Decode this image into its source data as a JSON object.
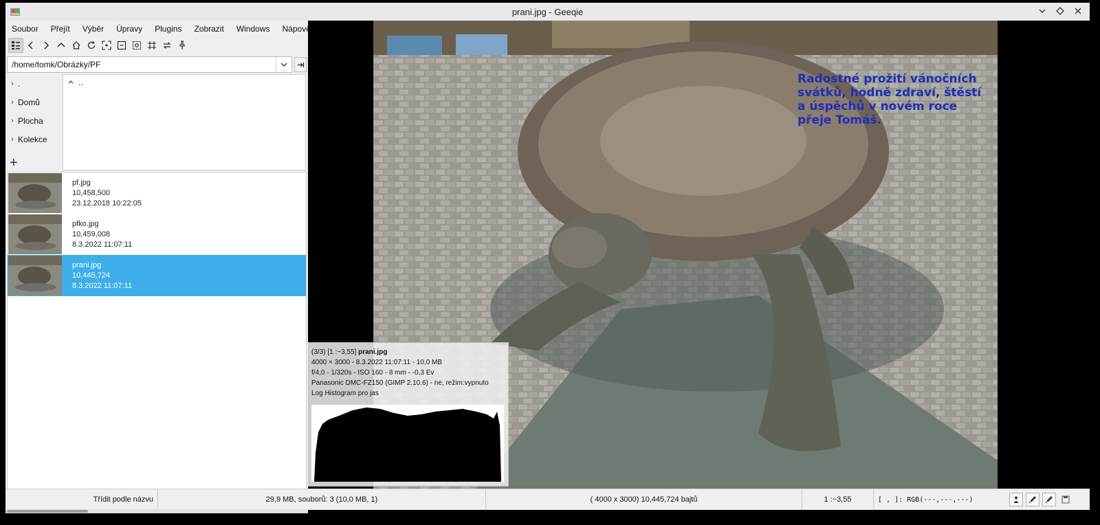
{
  "window": {
    "title": "prani.jpg - Geeqie"
  },
  "menu": [
    "Soubor",
    "Přejít",
    "Výběr",
    "Úpravy",
    "Plugins",
    "Zobrazit",
    "Windows",
    "Nápověda"
  ],
  "toolbar": {
    "icons": [
      "view-list-icon",
      "back-icon",
      "forward-icon",
      "up-icon",
      "home-icon",
      "refresh-icon",
      "zoom-in-icon",
      "zoom-fit-icon",
      "zoom-100-icon",
      "fullscreen-icon",
      "flip-icon",
      "pin-icon"
    ]
  },
  "path": {
    "value": "/home/tomk/Obrázky/PF"
  },
  "bookmarks": [
    ".",
    "Domů",
    "Plocha",
    "Kolekce"
  ],
  "dir_items": [
    ".."
  ],
  "files": [
    {
      "name": "pf.jpg",
      "size": "10,458,500",
      "date": "23.12.2018 10:22:05",
      "selected": false
    },
    {
      "name": "pfko.jpg",
      "size": "10,459,008",
      "date": "8.3.2022 11:07:11",
      "selected": false
    },
    {
      "name": "prani.jpg",
      "size": "10,445,724",
      "date": "8.3.2022 11:07:11",
      "selected": true
    }
  ],
  "image": {
    "greeting": "Radostné prožití vánočních svátků, hodně zdraví, štěstí a úspěchů v novém roce přeje Tomáš."
  },
  "overlay": {
    "line1_prefix": "(3/3) [1 :~3,55] ",
    "line1_name": "prani.jpg",
    "line2": "4000 × 3000 - 8.3.2022 11:07:11 - 10,0 MB",
    "line3": "f/4,0 - 1/320s - ISO 160 - 8 mm - -0,3 Ev",
    "line4": "Panasonic DMC-FZ150 (GIMP 2.10.6) - ne, režim:vypnuto",
    "line5": "Log Histogram pro jas"
  },
  "status": {
    "sort": "Třídit podle názvu",
    "summary": "29,9 MB, souborů: 3 (10,0 MB, 1)",
    "image_info": "( 4000 x 3000) 10,445,724 bajtů",
    "zoom": "1 :~3,55",
    "pixel": "[      ,      ]:  RGB(---,---,---)"
  }
}
